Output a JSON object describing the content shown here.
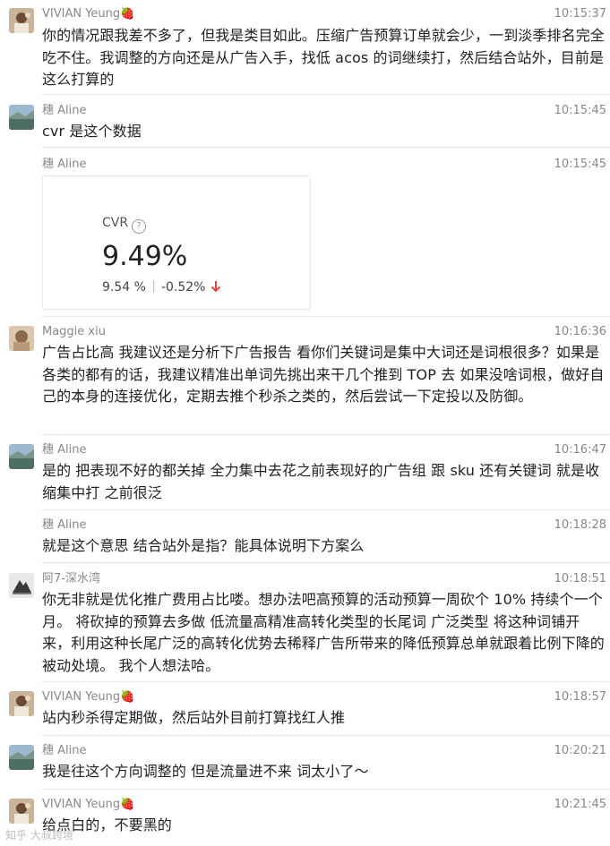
{
  "messages": [
    {
      "sender": "VIVIAN  Yeung🍓",
      "time": "10:15:37",
      "text": "你的情况跟我差不多了，但我是类目如此。压缩广告预算订单就会少，一到淡季排名完全吃不住。我调整的方向还是从广告入手，找低 acos 的词继续打，然后结合站外，目前是这么打算的"
    },
    {
      "sender": "穗 Aline",
      "time": "10:15:45",
      "text": "cvr 是这个数据"
    },
    {
      "sender": "穗 Aline",
      "time": "10:15:45"
    },
    {
      "sender": "Maggie xiu",
      "time": "10:16:36",
      "text": "广告占比高  我建议还是分析下广告报告  看你们关键词是集中大词还是词根很多？如果是各类的都有的话，我建议精准出单词先挑出来干几个推到 TOP 去  如果没啥词根，做好自己的本身的连接优化，定期去推个秒杀之类的，然后尝试一下定投以及防御。"
    },
    {
      "sender": "穗 Aline",
      "time": "10:16:47",
      "text": "是的 把表现不好的都关掉  全力集中去花之前表现好的广告组 跟 sku 还有关键词  就是收缩集中打  之前很泛"
    },
    {
      "sender": "穗 Aline",
      "time": "10:18:28",
      "text": "就是这个意思 结合站外是指？能具体说明下方案么"
    },
    {
      "sender": "阿7-深水湾",
      "time": "10:18:51",
      "text": "你无非就是优化推广费用占比喽。想办法吧高预算的活动预算一周砍个 10% 持续个一个月。  将砍掉的预算去多做 低流量高精准高转化类型的长尾词 广泛类型 将这种词铺开来，利用这种长尾广泛的高转化优势去稀释广告所带来的降低预算总单就跟着比例下降的被动处境。  我个人想法哈。"
    },
    {
      "sender": "VIVIAN  Yeung🍓",
      "time": "10:18:57",
      "text": "站内秒杀得定期做，然后站外目前打算找红人推"
    },
    {
      "sender": "穗 Aline",
      "time": "10:20:21",
      "text": "我是往这个方向调整的 但是流量进不来 词太小了～"
    },
    {
      "sender": "VIVIAN  Yeung🍓",
      "time": "10:21:45",
      "text": "给点白的，不要黑的"
    }
  ],
  "card": {
    "label": "CVR",
    "help_icon": "?",
    "value": "9.49%",
    "previous": "9.54 %",
    "change": "-0.52%",
    "change_color": "#e04646",
    "arrow_icon": "down-arrow-icon"
  },
  "watermark": "知乎 大叔跨境"
}
